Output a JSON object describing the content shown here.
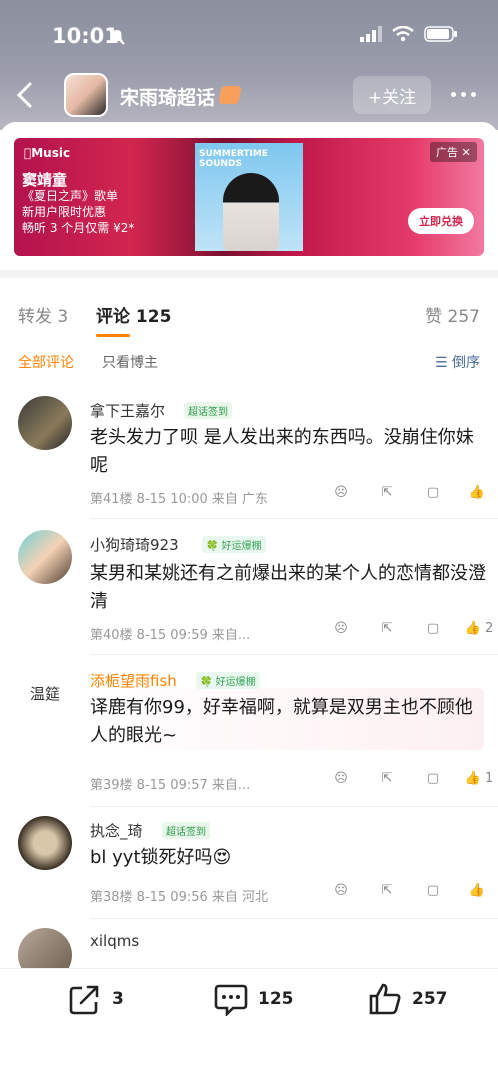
{
  "status": {
    "time": "10:01"
  },
  "header": {
    "title": "宋雨琦超话",
    "follow_label": "+关注"
  },
  "ad": {
    "brand": "Music",
    "line1": "窦靖童",
    "line2": "《夏日之声》歌单",
    "line3": "新用户限时优惠",
    "line4": "畅听 3 个月仅需 ¥2*",
    "album_title": "SUMMERTIME SOUNDS",
    "tag": "广告",
    "button": "立即兑换"
  },
  "tabs": {
    "repost": "转发 3",
    "comments": "评论 125",
    "likes": "赞 257"
  },
  "filters": {
    "all": "全部评论",
    "host_only": "只看博主",
    "sort": "倒序"
  },
  "comments": [
    {
      "name": "拿下王嘉尔",
      "badge": "超话签到",
      "text": "老头发力了呗 是人发出来的东西吗。没崩住你妹呢",
      "meta": "第41楼  8-15 10:00  来自 广东",
      "likes": ""
    },
    {
      "name": "小狗琦琦923",
      "badge": "好运爆棚",
      "text": "某男和某姚还有之前爆出来的某个人的恋情都没澄清",
      "meta": "第40楼  8-15 09:59  来自...",
      "likes": "2"
    },
    {
      "name": "添栀望雨fish",
      "badge": "好运爆棚",
      "text": "译鹿有你99，好幸福啊，就算是双男主也不顾他人的眼光~",
      "meta": "第39楼  8-15 09:57  来自...",
      "likes": "1"
    },
    {
      "name": "执念_琦",
      "badge": "超话签到",
      "text": "bl yyt锁死好吗😍",
      "meta": "第38楼  8-15 09:56  来自 河北",
      "likes": ""
    },
    {
      "name": "xilqms",
      "badge": "",
      "text": "",
      "meta": "",
      "likes": ""
    }
  ],
  "bottom": {
    "repost_count": "3",
    "comment_count": "125",
    "like_count": "257"
  },
  "colors": {
    "accent": "#ff8200",
    "link": "#4a6a9a"
  }
}
